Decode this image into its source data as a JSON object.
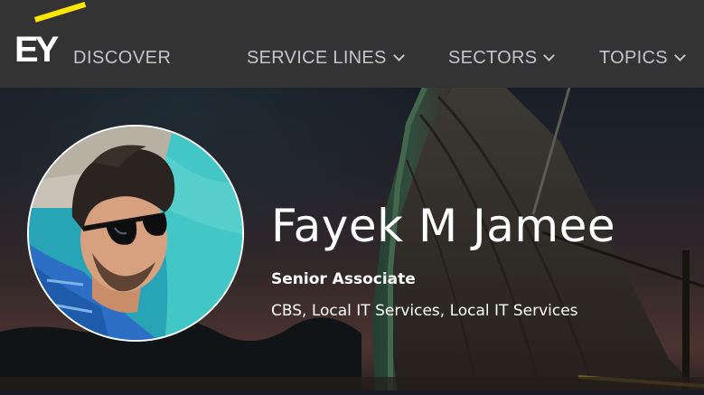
{
  "header": {
    "logo_text": "EY",
    "brand": "DISCOVER",
    "nav": [
      {
        "label": "SERVICE LINES",
        "icon": "chevron-down-icon"
      },
      {
        "label": "SECTORS",
        "icon": "chevron-down-icon"
      },
      {
        "label": "TOPICS",
        "icon": "chevron-down-icon"
      }
    ]
  },
  "profile": {
    "name": "Fayek M Jamee",
    "title": "Senior Associate",
    "department": "CBS, Local IT Services, Local IT Services"
  },
  "colors": {
    "header_bg": "#333333",
    "logo_accent": "#ffe600",
    "nav_text": "#c4c4cd"
  }
}
